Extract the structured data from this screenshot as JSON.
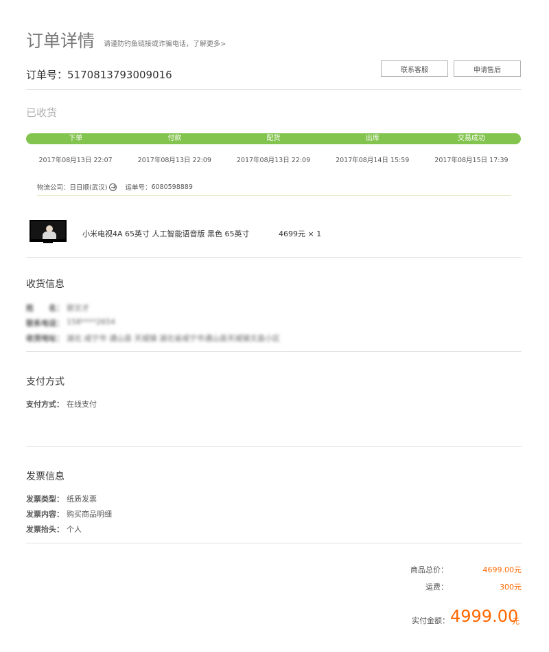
{
  "header": {
    "title": "订单详情",
    "note": "请谨防钓鱼链接或诈骗电话，了解更多>"
  },
  "order": {
    "number_label": "订单号：",
    "number": "5170813793009016",
    "buttons": {
      "service": "联系客服",
      "aftersale": "申请售后"
    },
    "status": "已收货"
  },
  "progress": {
    "color": "#83c44e",
    "steps": [
      {
        "label": "下单",
        "time": "2017年08月13日 22:07"
      },
      {
        "label": "付款",
        "time": "2017年08月13日 22:09"
      },
      {
        "label": "配货",
        "time": "2017年08月13日 22:09"
      },
      {
        "label": "出库",
        "time": "2017年08月14日 15:59"
      },
      {
        "label": "交易成功",
        "time": "2017年08月15日 17:39"
      }
    ]
  },
  "logistics": {
    "company_label": "物流公司：",
    "company": "日日顺(武汉)",
    "tracking_label": "运单号：",
    "tracking": "6080598889"
  },
  "product": {
    "name": "小米电视4A 65英寸 人工智能语音版 黑色 65英寸",
    "price": "4699元 × 1"
  },
  "shipping": {
    "title": "收货信息",
    "name_label": "姓　　名：",
    "name": "郭文才",
    "phone_label": "联系电话：",
    "phone": "158****2654",
    "address_label": "收货地址：",
    "address": "湖北 咸宁市 通山县 天城镇 湖北省咸宁市通山县天城镇文昌小区"
  },
  "payment": {
    "title": "支付方式",
    "method_label": "支付方式：",
    "method": "在线支付"
  },
  "invoice": {
    "title": "发票信息",
    "type_label": "发票类型：",
    "type": "纸质发票",
    "content_label": "发票内容：",
    "content": "购买商品明细",
    "header_label": "发票抬头：",
    "header": "个人"
  },
  "summary": {
    "goods_label": "商品总价：",
    "goods": "4699.00元",
    "freight_label": "运费：",
    "freight": "300元",
    "total_label": "实付金额：",
    "total": "4999.00",
    "total_unit": "元",
    "accent": "#ff6700"
  }
}
